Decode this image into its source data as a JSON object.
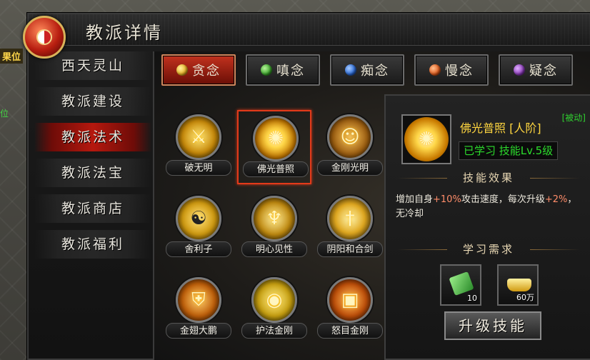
{
  "world": {
    "left_text_1": "果位",
    "left_text_2": "位"
  },
  "window": {
    "title": "教派详情"
  },
  "sidebar": {
    "items": [
      {
        "label": "西天灵山"
      },
      {
        "label": "教派建设"
      },
      {
        "label": "教派法术",
        "active": true
      },
      {
        "label": "教派法宝"
      },
      {
        "label": "教派商店"
      },
      {
        "label": "教派福利"
      }
    ]
  },
  "tabs": [
    {
      "label": "贪念",
      "active": true,
      "color": "#e8b020"
    },
    {
      "label": "嗔念",
      "color": "#3aa52a"
    },
    {
      "label": "痴念",
      "color": "#2a6ad8"
    },
    {
      "label": "慢念",
      "color": "#e05a1a"
    },
    {
      "label": "疑念",
      "color": "#8a3ab8"
    }
  ],
  "skills": [
    {
      "label": "破无明",
      "icon": "spear-icon"
    },
    {
      "label": "佛光普照",
      "icon": "holy-light-icon",
      "selected": true
    },
    {
      "label": "金刚光明",
      "icon": "warrior-icon"
    },
    {
      "label": "舍利子",
      "icon": "yin-yang-icon"
    },
    {
      "label": "明心见性",
      "icon": "monk-icon"
    },
    {
      "label": "阴阳和合剑",
      "icon": "sword-icon"
    },
    {
      "label": "金翅大鹏",
      "icon": "shield-icon"
    },
    {
      "label": "护法金刚",
      "icon": "eye-staff-icon"
    },
    {
      "label": "怒目金刚",
      "icon": "fire-book-icon"
    }
  ],
  "detail": {
    "passive_tag": "[被动]",
    "skill_name": "佛光普照 [人阶]",
    "learned_text": "已学习 技能Lv.5级",
    "effect_header": "技能效果",
    "desc_part1": "增加自身",
    "desc_hl1": "+10%",
    "desc_part2": "攻击速度，每次升级",
    "desc_hl2": "+2%",
    "desc_part3": "，",
    "desc_line2": "无冷却",
    "req_header": "学习需求",
    "req_items": [
      {
        "icon": "jade-scroll-icon",
        "qty": "10"
      },
      {
        "icon": "gold-ingot-icon",
        "qty": "60万"
      }
    ],
    "upgrade_label": "升级技能"
  }
}
